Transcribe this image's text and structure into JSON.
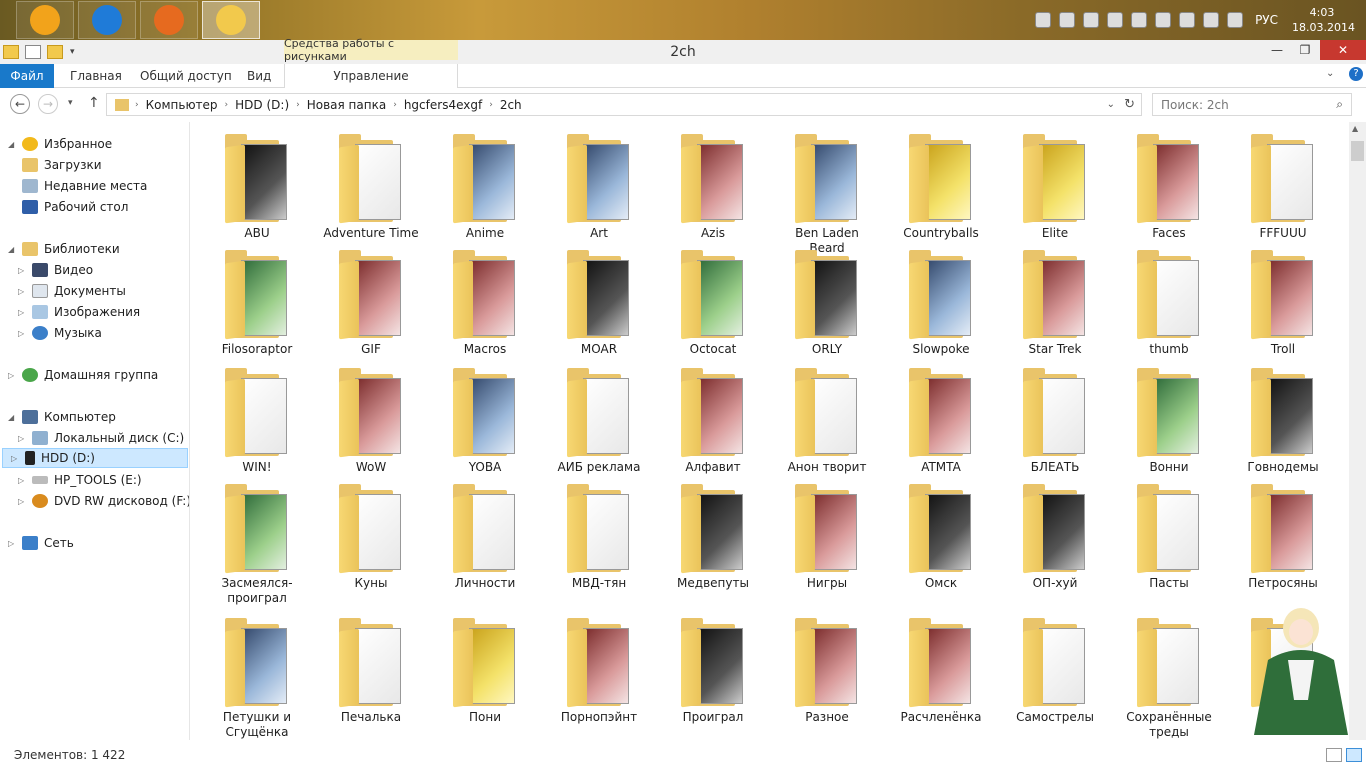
{
  "taskbar": {
    "apps": [
      {
        "name": "aimp",
        "color": "#f2a31b"
      },
      {
        "name": "teamviewer",
        "color": "#1f7bd8"
      },
      {
        "name": "firefox",
        "color": "#e66a1f"
      },
      {
        "name": "explorer",
        "color": "#f2c94c"
      }
    ],
    "language": "РУС",
    "time": "4:03",
    "date": "18.03.2014"
  },
  "window": {
    "title": "2ch",
    "contextual_tab_group": "Средства работы с рисунками",
    "min_label": "—",
    "max_label": "❐",
    "close_label": "✕"
  },
  "ribbon": {
    "tabs": [
      "Файл",
      "Главная",
      "Общий доступ",
      "Вид",
      "Управление"
    ]
  },
  "address": {
    "breadcrumbs": [
      "Компьютер",
      "HDD (D:)",
      "Новая папка",
      "hgcfers4exgf",
      "2ch"
    ],
    "search_placeholder": "Поиск: 2ch"
  },
  "nav": {
    "favorites": "Избранное",
    "favorites_items": [
      "Загрузки",
      "Недавние места",
      "Рабочий стол"
    ],
    "libraries": "Библиотеки",
    "libraries_items": [
      "Видео",
      "Документы",
      "Изображения",
      "Музыка"
    ],
    "homegroup": "Домашняя группа",
    "computer": "Компьютер",
    "computer_items": [
      "Локальный диск (C:)",
      "HDD (D:)",
      "HP_TOOLS (E:)",
      "DVD RW дисковод (F:) ser"
    ],
    "network": "Сеть"
  },
  "folders": [
    {
      "name": "ABU",
      "pic": "dark"
    },
    {
      "name": "Adventure Time",
      "pic": "white"
    },
    {
      "name": "Anime",
      "pic": "blue"
    },
    {
      "name": "Art",
      "pic": "blue"
    },
    {
      "name": "Azis",
      "pic": "red"
    },
    {
      "name": "Ben Laden Beard",
      "pic": "blue"
    },
    {
      "name": "Countryballs",
      "pic": "yellow"
    },
    {
      "name": "Elite",
      "pic": "yellow"
    },
    {
      "name": "Faces",
      "pic": "red"
    },
    {
      "name": "FFFUUU",
      "pic": "white"
    },
    {
      "name": "Filosoraptor",
      "pic": "green"
    },
    {
      "name": "GIF",
      "pic": "red"
    },
    {
      "name": "Macros",
      "pic": "red"
    },
    {
      "name": "MOAR",
      "pic": "dark"
    },
    {
      "name": "Octocat",
      "pic": "green"
    },
    {
      "name": "ORLY",
      "pic": "dark"
    },
    {
      "name": "Slowpoke",
      "pic": "blue"
    },
    {
      "name": "Star Trek",
      "pic": "red"
    },
    {
      "name": "thumb",
      "pic": "white"
    },
    {
      "name": "Troll",
      "pic": "red"
    },
    {
      "name": "WIN!",
      "pic": "white"
    },
    {
      "name": "WoW",
      "pic": "red"
    },
    {
      "name": "YOBA",
      "pic": "blue"
    },
    {
      "name": "АИБ реклама",
      "pic": "white"
    },
    {
      "name": "Алфавит",
      "pic": "red"
    },
    {
      "name": "Анон творит",
      "pic": "white"
    },
    {
      "name": "ATMTA",
      "pic": "red"
    },
    {
      "name": "БЛЕАТЬ",
      "pic": "white"
    },
    {
      "name": "Вонни",
      "pic": "green"
    },
    {
      "name": "Говнодемы",
      "pic": "dark"
    },
    {
      "name": "Засмеялся-проиграл",
      "pic": "green"
    },
    {
      "name": "Куны",
      "pic": "white"
    },
    {
      "name": "Личности",
      "pic": "white"
    },
    {
      "name": "МВД-тян",
      "pic": "white"
    },
    {
      "name": "Медвепуты",
      "pic": "dark"
    },
    {
      "name": "Нигры",
      "pic": "red"
    },
    {
      "name": "Омск",
      "pic": "dark"
    },
    {
      "name": "ОП-хуй",
      "pic": "dark"
    },
    {
      "name": "Пасты",
      "pic": "white"
    },
    {
      "name": "Петросяны",
      "pic": "red"
    },
    {
      "name": "Петушки и Сгущёнка",
      "pic": "blue"
    },
    {
      "name": "Печалька",
      "pic": "white"
    },
    {
      "name": "Пони",
      "pic": "yellow"
    },
    {
      "name": "Порнопэйнт",
      "pic": "red"
    },
    {
      "name": "Проиграл",
      "pic": "dark"
    },
    {
      "name": "Разное",
      "pic": "red"
    },
    {
      "name": "Расчленёнка",
      "pic": "red"
    },
    {
      "name": "Самострелы",
      "pic": "white"
    },
    {
      "name": "Сохранённые треды",
      "pic": "white"
    },
    {
      "name": "",
      "pic": "white"
    }
  ],
  "status": {
    "items_count": "Элементов: 1 422"
  },
  "colors": {
    "accent": "#1979ca",
    "close": "#c7382f",
    "folder": "#e9c46a",
    "selection": "#cde8ff"
  }
}
